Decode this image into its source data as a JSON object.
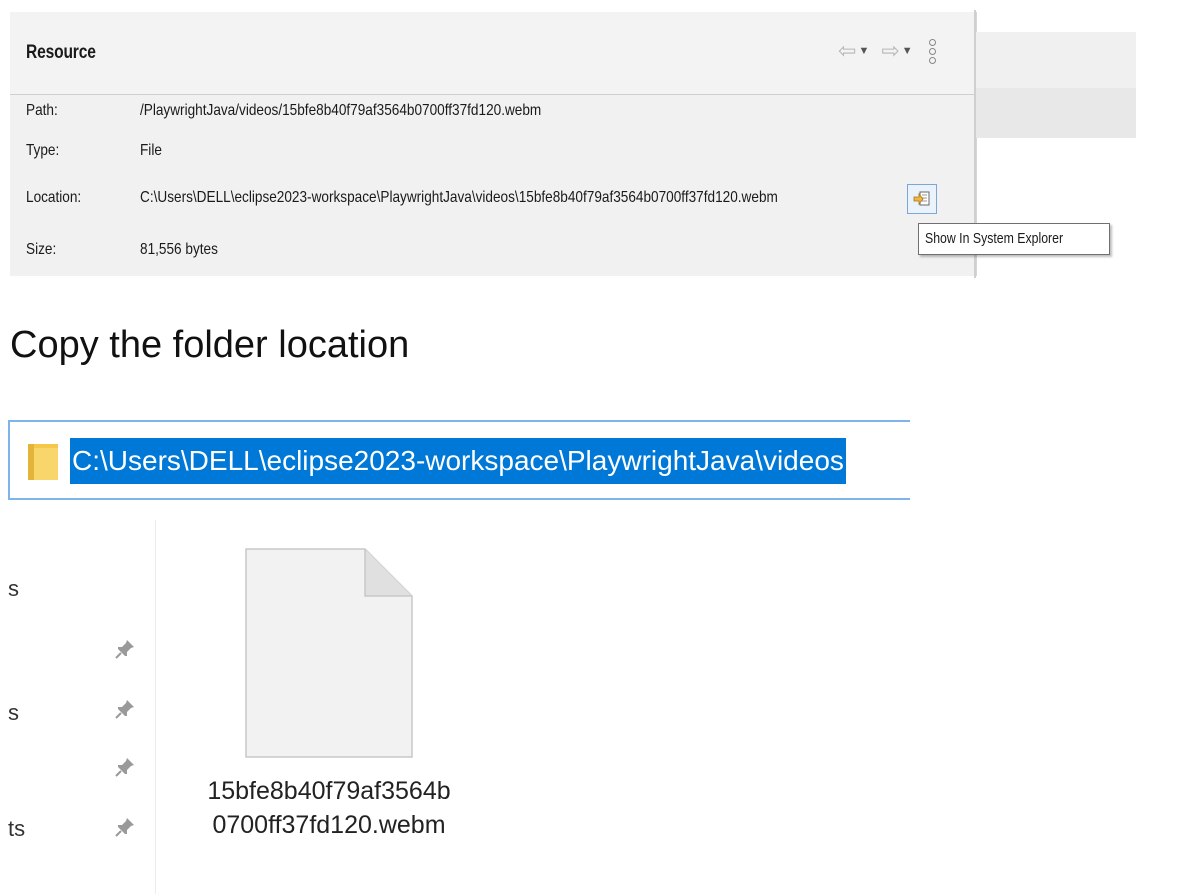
{
  "properties": {
    "title": "Resource",
    "rows": [
      {
        "label": "Path:",
        "value": "/PlaywrightJava/videos/15bfe8b40f79af3564b0700ff37fd120.webm"
      },
      {
        "label": "Type:",
        "value": "File"
      },
      {
        "label": "Location:",
        "value": "C:\\Users\\DELL\\eclipse2023-workspace\\PlaywrightJava\\videos\\15bfe8b40f79af3564b0700ff37fd120.webm"
      },
      {
        "label": "Size:",
        "value": "81,556  bytes"
      }
    ],
    "toolbar_icons": [
      "back-arrow-icon",
      "forward-arrow-icon",
      "view-menu-icon"
    ],
    "tooltip": "Show In System Explorer"
  },
  "instruction": "Copy the folder location",
  "explorer": {
    "address": "C:\\Users\\DELL\\eclipse2023-workspace\\PlaywrightJava\\videos",
    "nav_items": [
      "s",
      "s",
      "ts"
    ],
    "file_name": "15bfe8b40f79af3564b0700ff37fd120.webm"
  },
  "colors": {
    "selection": "#0078d7",
    "address_border": "#7eb4ea",
    "folder": "#f5c84c"
  }
}
